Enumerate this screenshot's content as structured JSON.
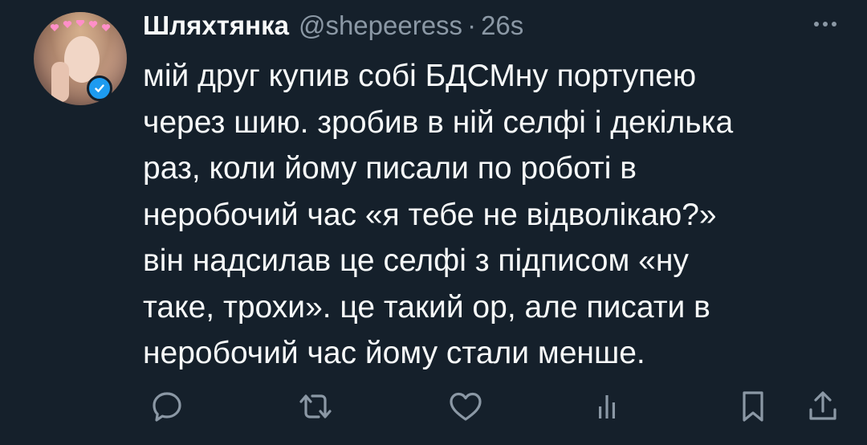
{
  "tweet": {
    "author_name": "Шляхтянка",
    "author_handle": "@shepeeress",
    "separator": "·",
    "timestamp": "26s",
    "text_lines": [
      "мій друг купив собі БДСМну портупею",
      "через шию. зробив в ній селфі і декілька",
      "раз, коли йому писали по роботі в",
      "неробочий час «я тебе не відволікаю?»",
      "він надсилав це селфі з підписом «ну",
      "таке, трохи». це такий ор, але писати в",
      "неробочий час йому стали менше."
    ]
  },
  "icons": {
    "verified": "verified-badge-icon",
    "more": "more-options-icon",
    "reply": "reply-icon",
    "retweet": "retweet-icon",
    "like": "heart-icon",
    "views": "views-bar-chart-icon",
    "bookmark": "bookmark-icon",
    "share": "share-icon"
  },
  "colors": {
    "background": "#15202b",
    "primary_text": "#f7f9f9",
    "secondary_text": "#8b98a5",
    "verified_blue": "#1d9bf0"
  }
}
